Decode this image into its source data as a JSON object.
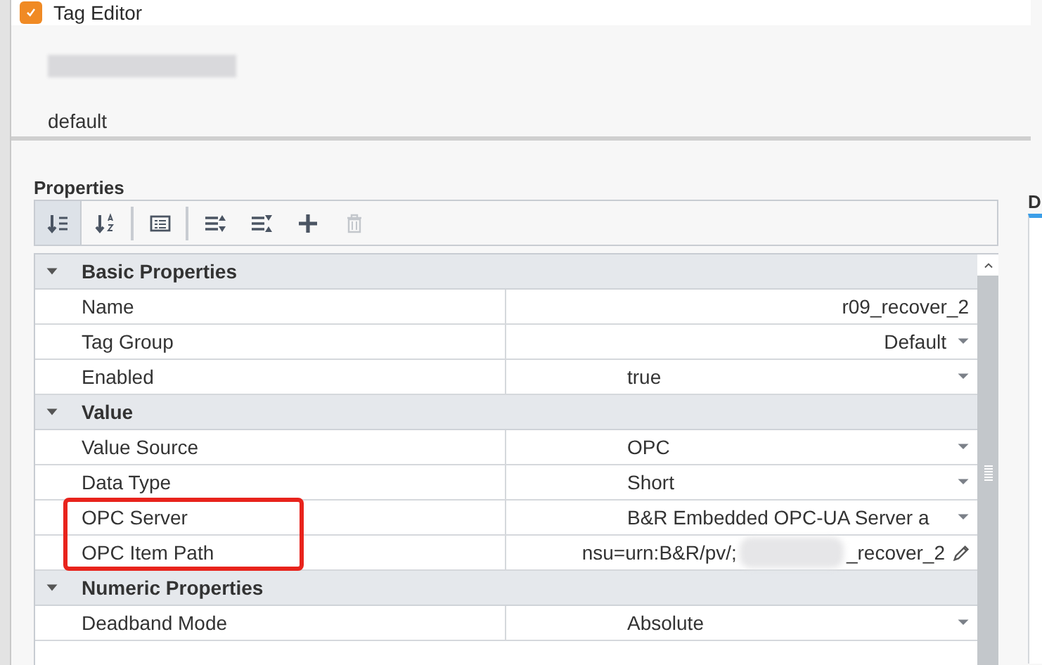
{
  "window": {
    "title": "Tag Editor"
  },
  "tag": {
    "provider": "default"
  },
  "properties": {
    "heading": "Properties",
    "toolbar": [
      {
        "kind": "categorized",
        "selected": true,
        "disabled": false
      },
      {
        "kind": "alphabetical",
        "selected": false,
        "disabled": false
      },
      {
        "kind": "description",
        "selected": false,
        "disabled": false
      },
      {
        "kind": "expand",
        "selected": false,
        "disabled": false
      },
      {
        "kind": "collapse",
        "selected": false,
        "disabled": false
      },
      {
        "kind": "add",
        "selected": false,
        "disabled": false
      },
      {
        "kind": "delete",
        "selected": false,
        "disabled": true
      }
    ],
    "rows": [
      {
        "kind": "section",
        "label": "Basic Properties",
        "expanded": true
      },
      {
        "kind": "text",
        "label": "Name",
        "value": "r09_recover_2",
        "highlighted": false
      },
      {
        "kind": "combo",
        "label": "Tag Group",
        "value": "Default",
        "highlighted": false
      },
      {
        "kind": "select",
        "label": "Enabled",
        "value": "true",
        "highlighted": false
      },
      {
        "kind": "section",
        "label": "Value",
        "expanded": true
      },
      {
        "kind": "select",
        "label": "Value Source",
        "value": "OPC",
        "highlighted": false
      },
      {
        "kind": "select",
        "label": "Data Type",
        "value": "Short",
        "highlighted": false
      },
      {
        "kind": "select",
        "label": "OPC Server",
        "value": "B&R Embedded OPC-UA Server a",
        "highlighted": true
      },
      {
        "kind": "path",
        "label": "OPC Item Path",
        "value": "nsu=urn:B&R/pv/;",
        "value_end": "_recover_2",
        "highlighted": true
      },
      {
        "kind": "section",
        "label": "Numeric Properties",
        "expanded": true
      },
      {
        "kind": "select",
        "label": "Deadband Mode",
        "value": "Absolute",
        "highlighted": false
      }
    ]
  },
  "side_panel": {
    "heading": "D"
  }
}
